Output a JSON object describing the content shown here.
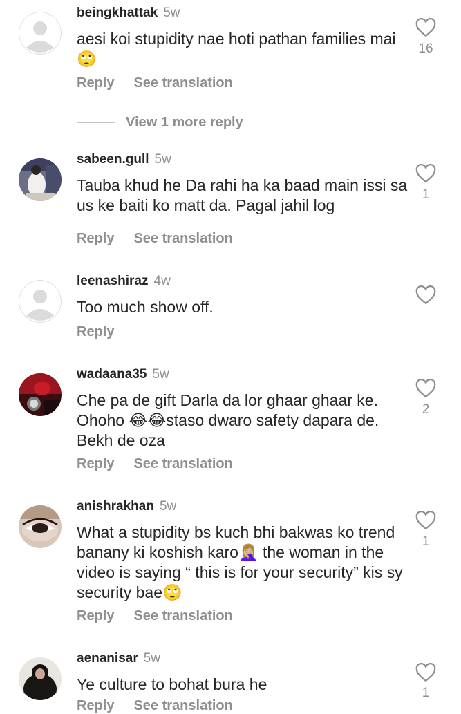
{
  "comments": [
    {
      "username": "beingkhattak",
      "time": "5w",
      "text": "aesi koi stupidity nae hoti pathan families mai 🙄",
      "reply_label": "Reply",
      "translate_label": "See translation",
      "likes": "16"
    },
    {
      "username": "sabeen.gull",
      "time": "5w",
      "text": "Tauba khud he Da rahi ha ka baad main issi sa us ke baiti ko matt da. Pagal jahil log",
      "reply_label": "Reply",
      "translate_label": "See translation",
      "likes": "1"
    },
    {
      "username": "leenashiraz",
      "time": "4w",
      "text": "Too much show off.",
      "reply_label": "Reply",
      "likes": ""
    },
    {
      "username": "wadaana35",
      "time": "5w",
      "text": "Che pa de gift Darla da lor ghaar ghaar ke. Ohoho 😂😂staso dwaro safety dapara de. Bekh de oza",
      "reply_label": "Reply",
      "translate_label": "See translation",
      "likes": "2"
    },
    {
      "username": "anishrakhan",
      "time": "5w",
      "text": "What a stupidity bs kuch bhi bakwas ko trend banany ki koshish karo🤦🏼‍♀️ the woman in the video is saying “ this is for your security” kis sy security bae🙄",
      "reply_label": "Reply",
      "translate_label": "See translation",
      "likes": "1"
    },
    {
      "username": "aenanisar",
      "time": "5w",
      "text": "Ye culture to bohat bura he",
      "reply_label": "Reply",
      "translate_label": "See translation",
      "likes": "1"
    }
  ],
  "view_more_replies": "View 1 more reply",
  "colors": {
    "primary_text": "#262626",
    "secondary_text": "#8e8e8e",
    "placeholder_avatar": "#dbdbdb"
  },
  "icons": {
    "like": "heart-outline-icon",
    "placeholder_avatar": "default-avatar-icon"
  }
}
